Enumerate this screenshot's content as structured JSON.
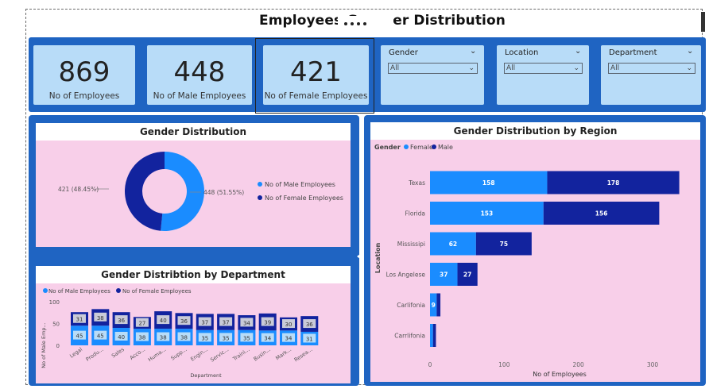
{
  "header": {
    "title": "Employees G",
    "title_end": "er Distribution"
  },
  "kpis": [
    {
      "value": "869",
      "label": "No of Employees"
    },
    {
      "value": "448",
      "label": "No of Male Employees"
    },
    {
      "value": "421",
      "label": "No of Female Employees"
    }
  ],
  "slicers": [
    {
      "label": "Gender",
      "value": "All"
    },
    {
      "label": "Location",
      "value": "All"
    },
    {
      "label": "Department",
      "value": "All"
    }
  ],
  "colors": {
    "male": "#1a8cff",
    "female": "#12239e",
    "panel": "#f8cfe9",
    "kpi": "#b8dcf8",
    "band": "#1f64c2"
  },
  "chart_data": [
    {
      "type": "donut",
      "title": "Gender Distribution",
      "series": [
        {
          "name": "No of Male Employees",
          "value": 448,
          "label": "448 (51.55%)"
        },
        {
          "name": "No of Female Employees",
          "value": 421,
          "label": "421 (48.45%)"
        }
      ]
    },
    {
      "type": "bar",
      "orientation": "horizontal",
      "stacked": true,
      "title": "Gender Distribution by Region",
      "legend_title": "Gender",
      "categories": [
        "Texas",
        "Florida",
        "Mississipi",
        "Los Angelese",
        "Carlifonia",
        "Carrlifonia"
      ],
      "series": [
        {
          "name": "Female",
          "values": [
            158,
            153,
            62,
            37,
            9,
            4
          ]
        },
        {
          "name": "Male",
          "values": [
            178,
            156,
            75,
            27,
            5,
            4
          ]
        }
      ],
      "data_labels": [
        [
          "158",
          "153",
          "62",
          "37",
          "9",
          ""
        ],
        [
          "178",
          "156",
          "75",
          "27",
          "",
          ""
        ]
      ],
      "xlabel": "No of Employees",
      "ylabel": "Location",
      "xticks": [
        "0",
        "100",
        "200",
        "300"
      ],
      "xlim": [
        0,
        330
      ]
    },
    {
      "type": "bar",
      "stacked": true,
      "title": "Gender Distribtion by Department",
      "categories": [
        "Legal",
        "Produ...",
        "Sales",
        "Acco...",
        "Huma...",
        "Supp...",
        "Engin...",
        "Servic...",
        "Traini...",
        "Busin...",
        "Mark...",
        "Resea..."
      ],
      "series": [
        {
          "name": "No of Male Employees",
          "values": [
            45,
            45,
            40,
            38,
            38,
            38,
            35,
            35,
            35,
            34,
            34,
            31
          ]
        },
        {
          "name": "No of Female Employees",
          "values": [
            31,
            38,
            36,
            27,
            40,
            36,
            37,
            37,
            34,
            39,
            30,
            36
          ]
        }
      ],
      "xlabel": "Department",
      "ylabel": "No of Male Emp...",
      "yticks": [
        "0",
        "50",
        "100"
      ],
      "ylim": [
        0,
        100
      ]
    }
  ]
}
